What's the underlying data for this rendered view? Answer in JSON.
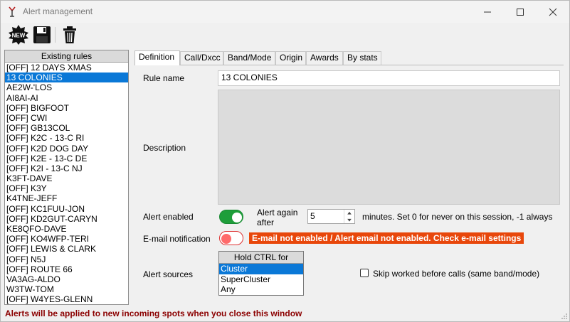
{
  "window": {
    "title": "Alert management",
    "icon": "antenna-app-icon",
    "controls": [
      "minimize-icon",
      "maximize-icon",
      "close-icon"
    ]
  },
  "toolbar": {
    "buttons": [
      {
        "name": "new-icon",
        "label": "NEW"
      },
      {
        "name": "save-icon",
        "label": ""
      },
      {
        "name": "trash-icon",
        "label": ""
      }
    ]
  },
  "rules": {
    "header": "Existing rules",
    "selected_index": 1,
    "items": [
      "[OFF] 12 DAYS XMAS",
      "13 COLONIES",
      "AE2W-'LOS",
      "AI8AI-AI",
      "[OFF] BIGFOOT",
      "[OFF] CWI",
      "[OFF] GB13COL",
      "[OFF] K2C - 13-C RI",
      "[OFF] K2D DOG DAY",
      "[OFF] K2E - 13-C DE",
      "[OFF] K2I - 13-C NJ",
      "K3FT-DAVE",
      "[OFF] K3Y",
      "K4TNE-JEFF",
      "[OFF] KC1FUU-JON",
      "[OFF] KD2GUT-CARYN",
      "KE8QFO-DAVE",
      "[OFF] KO4WFP-TERI",
      "[OFF] LEWIS & CLARK",
      "[OFF] N5J",
      "[OFF] ROUTE 66",
      "VA3AG-ALDO",
      "W3TW-TOM",
      "[OFF] W4YES-GLENN"
    ]
  },
  "tabs": [
    "Definition",
    "Call/Dxcc",
    "Band/Mode",
    "Origin",
    "Awards",
    "By stats"
  ],
  "active_tab": "Definition",
  "definition": {
    "rule_name_label": "Rule name",
    "rule_name_value": "13 COLONIES",
    "description_label": "Description",
    "description_value": "",
    "alert_enabled_label": "Alert enabled",
    "alert_enabled": true,
    "alert_again_label": "Alert again after",
    "alert_again_value": "5",
    "alert_again_suffix": "minutes. Set 0 for never on this session, -1 always",
    "email_label": "E-mail notification",
    "email_enabled": false,
    "email_warning": "E-mail not enabled / Alert email not enabled. Check e-mail settings",
    "sources_label": "Alert sources",
    "sources_header": "Hold CTRL for",
    "sources": [
      "Cluster",
      "SuperCluster",
      "Any"
    ],
    "sources_selected": 0,
    "skip_worked_label": "Skip worked before calls (same band/mode)",
    "skip_worked_checked": false
  },
  "status": "Alerts will be applied to new incoming spots when you close this window",
  "colors": {
    "selection": "#0a78d7",
    "toggle_on": "#1e9e3a",
    "toggle_off": "#ff6a6a",
    "warning_bg": "#e8470b",
    "status_text": "#8b0000"
  }
}
